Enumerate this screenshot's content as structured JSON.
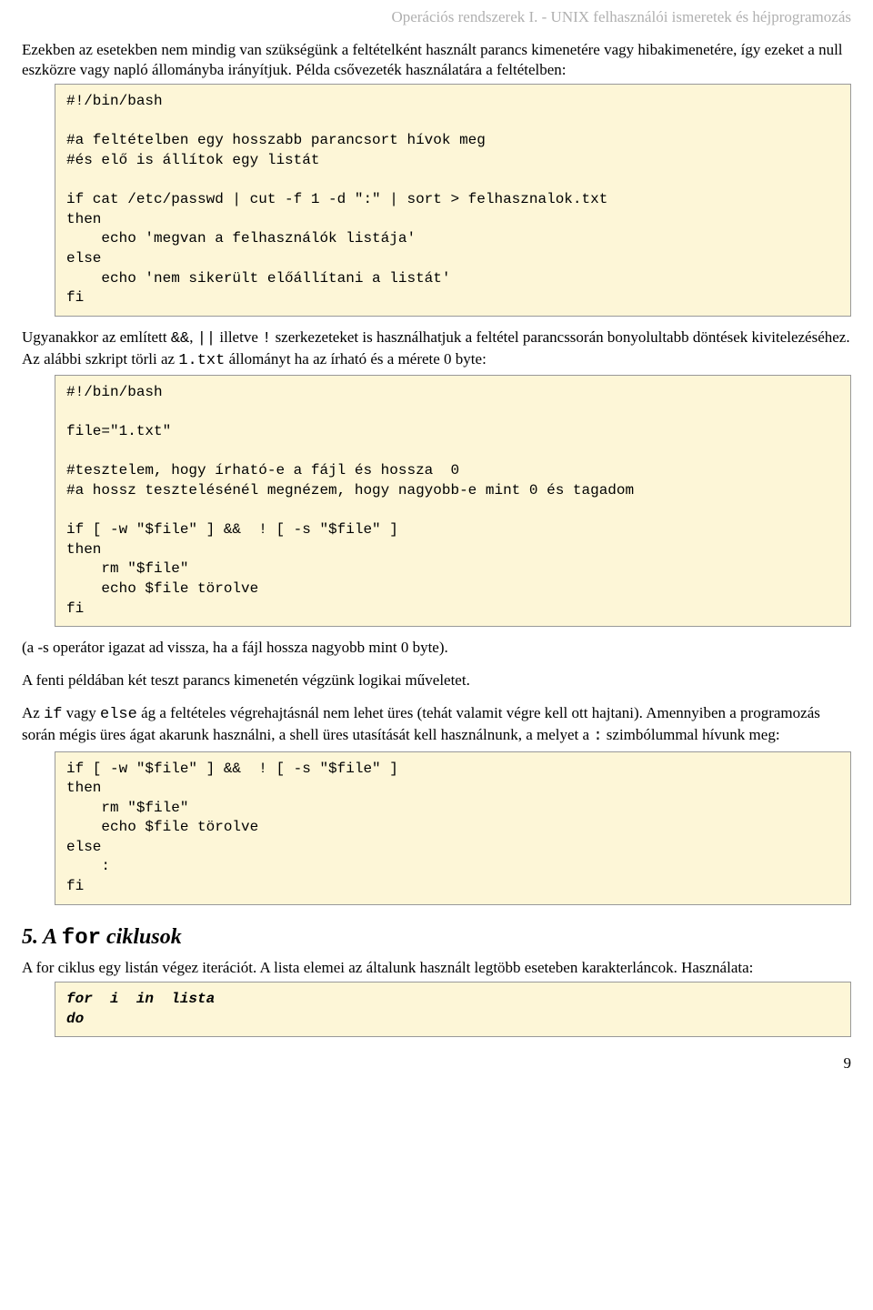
{
  "header": "Operációs rendszerek I. - UNIX felhasználói ismeretek és héjprogramozás",
  "para1": "Ezekben az esetekben nem mindig van szükségünk a feltételként használt parancs kimenetére vagy hibakimenetére, így ezeket a null eszközre vagy napló állományba irányítjuk. Példa csővezeték használatára a feltételben:",
  "code1": "#!/bin/bash\n\n#a feltételben egy hosszabb parancsort hívok meg\n#és elő is állítok egy listát\n\nif cat /etc/passwd | cut -f 1 -d \":\" | sort > felhasznalok.txt\nthen\n    echo 'megvan a felhasználók listája'\nelse\n    echo 'nem sikerült előállítani a listát'\nfi",
  "para2a": "Ugyanakkor az említett ",
  "para2_code1": "&&",
  "para2b": ", ",
  "para2_code2": "||",
  "para2c": " illetve ",
  "para2_code3": " !",
  "para2d": " szerkezeteket is használhatjuk a feltétel parancssorán bonyolultabb döntések kivitelezéséhez. Az alábbi szkript törli az ",
  "para2_code4": "1.txt",
  "para2e": " állományt ha az írható és a mérete 0 byte:",
  "code2": "#!/bin/bash\n\nfile=\"1.txt\"\n\n#tesztelem, hogy írható-e a fájl és hossza  0\n#a hossz tesztelésénél megnézem, hogy nagyobb-e mint 0 és tagadom\n\nif [ -w \"$file\" ] &&  ! [ -s \"$file\" ]\nthen\n    rm \"$file\"\n    echo $file törolve\nfi",
  "para3": "(a -s operátor igazat ad vissza, ha a fájl hossza nagyobb mint 0 byte).",
  "para4": "A fenti példában két teszt parancs kimenetén végzünk logikai műveletet.",
  "para5a": "Az ",
  "para5_code1": "if",
  "para5b": " vagy ",
  "para5_code2": "else",
  "para5c": " ág a feltételes végrehajtásnál nem lehet üres (tehát valamit végre kell ott hajtani). Amennyiben a programozás során mégis üres ágat akarunk használni, a shell üres utasítását kell használnunk, a melyet a ",
  "para5_code3": ":",
  "para5d": " szimbólummal hívunk meg:",
  "code3": "if [ -w \"$file\" ] &&  ! [ -s \"$file\" ]\nthen\n    rm \"$file\"\n    echo $file törolve\nelse\n    :\nfi",
  "h2_a": "5. A ",
  "h2_code": "for",
  "h2_b": " ciklusok",
  "para6": "A for ciklus egy listán végez iterációt. A lista elemei az általunk használt legtöbb eseteben karakterláncok. Használata:",
  "code4": "for  i  in  lista\ndo",
  "pagenum": "9"
}
